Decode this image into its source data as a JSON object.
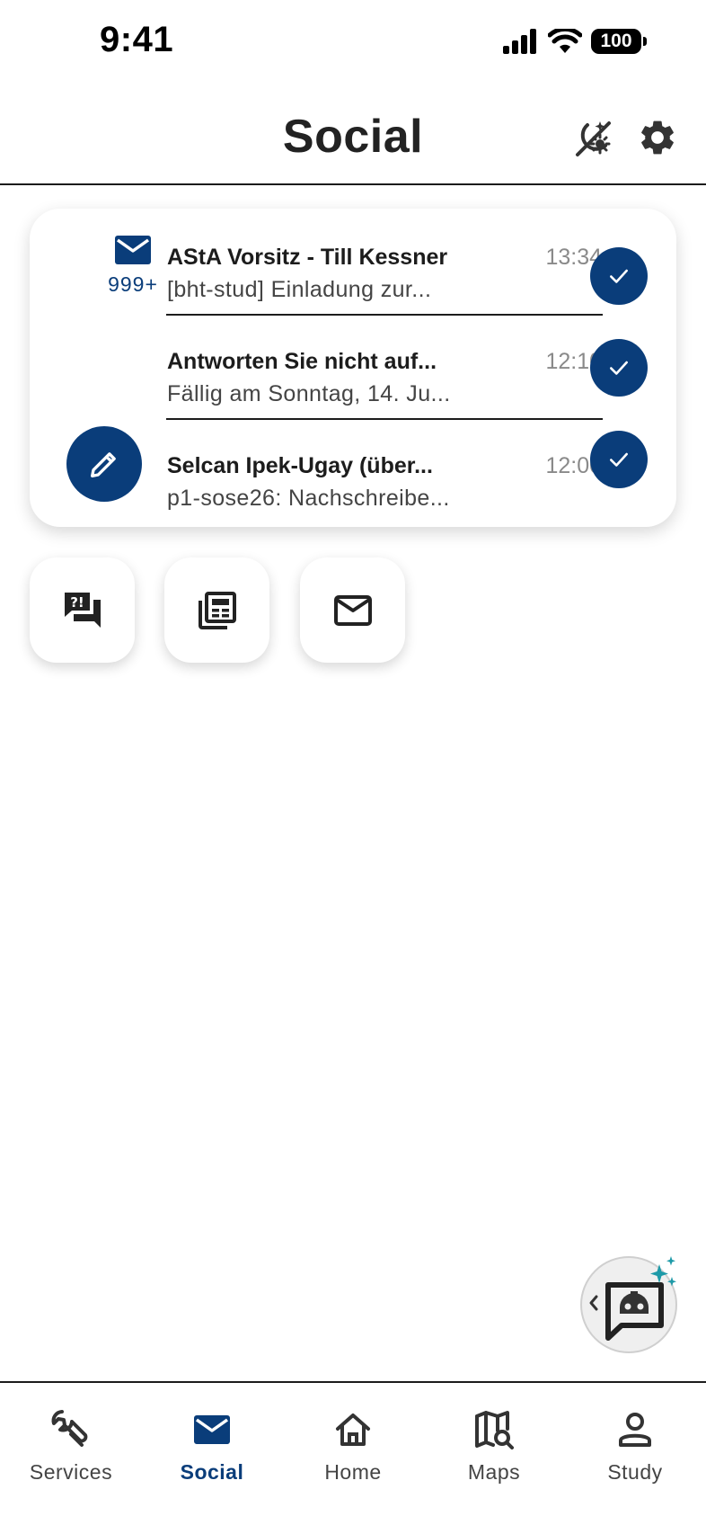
{
  "status_bar": {
    "time": "9:41",
    "battery": "100"
  },
  "header": {
    "title": "Social"
  },
  "mail_summary": {
    "unread_count": "999+"
  },
  "messages": [
    {
      "sender": "AStA Vorsitz - Till Kessner",
      "time": "13:34",
      "preview": "[bht-stud] Einladung zur..."
    },
    {
      "sender": "Antworten Sie nicht auf...",
      "time": "12:10",
      "preview": "Fällig am Sonntag, 14. Ju..."
    },
    {
      "sender": "Selcan Ipek-Ugay (über...",
      "time": "12:00",
      "preview": "p1-sose26: Nachschreibe..."
    }
  ],
  "quick_actions": [
    "feedback-icon",
    "news-icon",
    "mail-outline-icon"
  ],
  "tabs": [
    {
      "label": "Services",
      "icon": "wrench-icon",
      "active": false
    },
    {
      "label": "Social",
      "icon": "mail-icon",
      "active": true
    },
    {
      "label": "Home",
      "icon": "home-icon",
      "active": false
    },
    {
      "label": "Maps",
      "icon": "map-search-icon",
      "active": false
    },
    {
      "label": "Study",
      "icon": "person-icon",
      "active": false
    }
  ],
  "colors": {
    "accent": "#0a3d7a",
    "assistant_sparkle": "#1e9aa8"
  }
}
